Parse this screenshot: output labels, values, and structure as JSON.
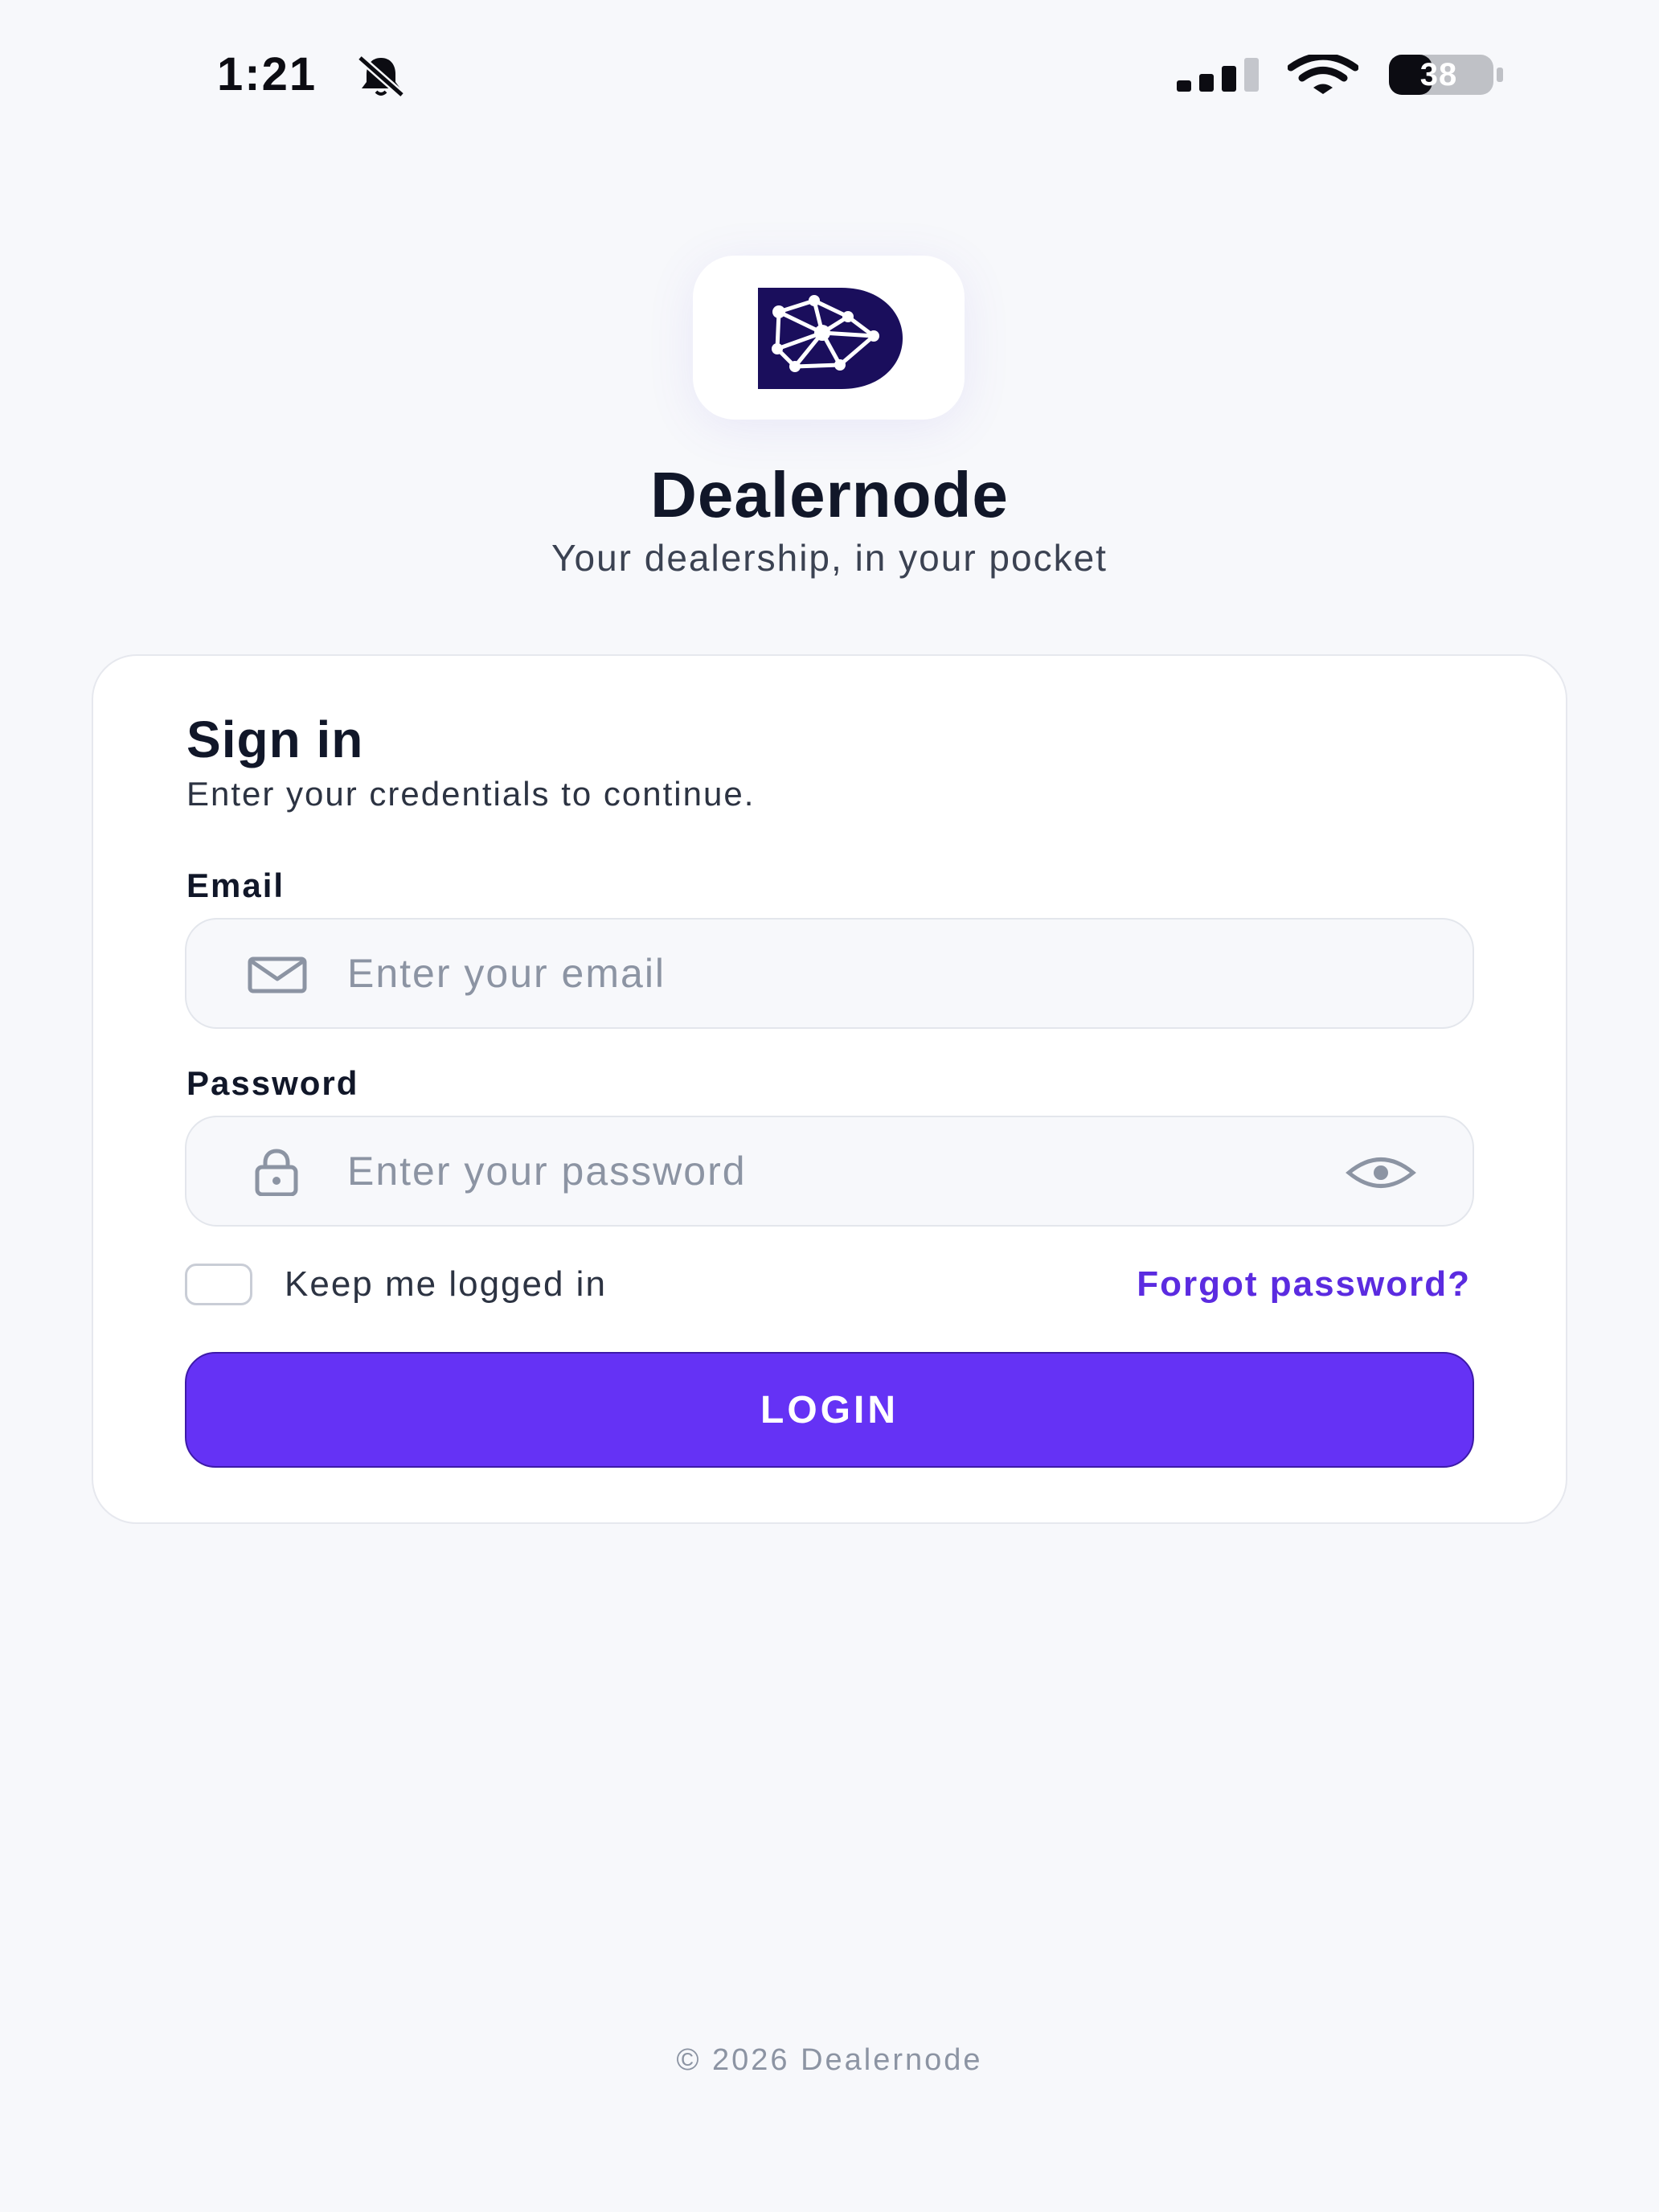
{
  "status_bar": {
    "time": "1:21",
    "battery_level": "38",
    "icons": [
      "bell-slash-icon",
      "signal-icon",
      "wifi-icon",
      "battery-icon"
    ]
  },
  "brand": {
    "name": "Dealernode",
    "tagline": "Your dealership, in your pocket",
    "logo_color": "#1a0e5c"
  },
  "sign_in": {
    "title": "Sign in",
    "subtitle": "Enter your credentials to continue.",
    "email": {
      "label": "Email",
      "value": "",
      "placeholder": "Enter your email",
      "icon": "mail-icon"
    },
    "password": {
      "label": "Password",
      "value": "",
      "placeholder": "Enter your password",
      "icon": "lock-icon",
      "toggle_icon": "eye-icon"
    },
    "remember": {
      "label": "Keep me logged in",
      "checked": false
    },
    "forgot_label": "Forgot password?",
    "login_label": "LOGIN"
  },
  "footer": {
    "text": "© 2026 Dealernode"
  },
  "colors": {
    "accent": "#6532f5",
    "link": "#5b2be0",
    "background": "#f7f8fb"
  }
}
